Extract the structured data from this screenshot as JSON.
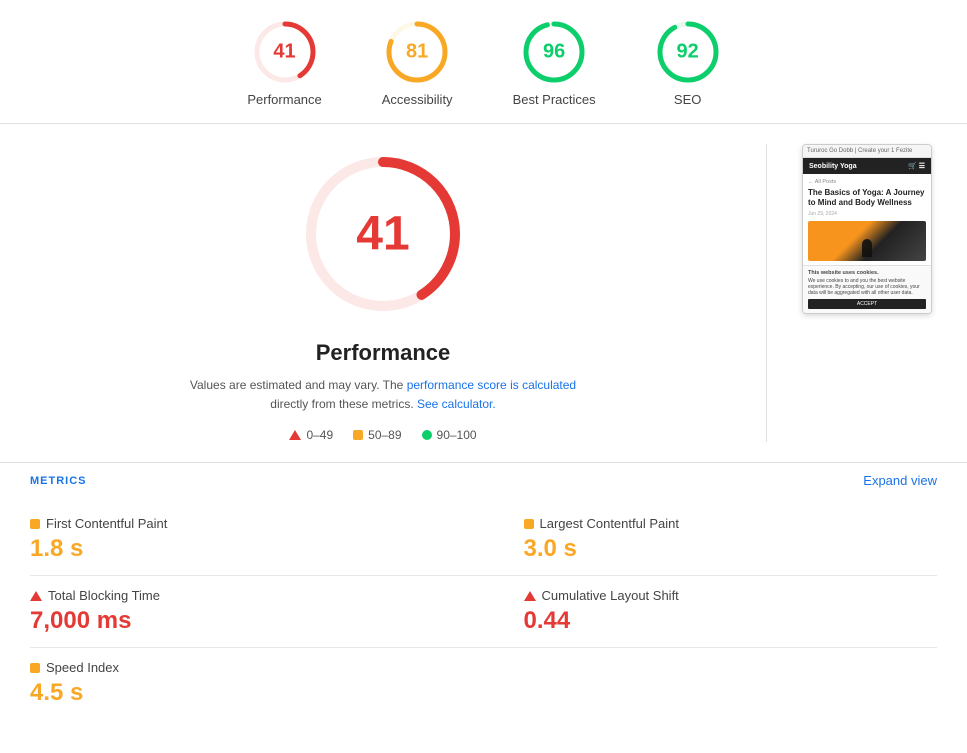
{
  "scores": [
    {
      "id": "performance",
      "label": "Performance",
      "value": 41,
      "color": "#e53935",
      "trackColor": "#fce8e6"
    },
    {
      "id": "accessibility",
      "label": "Accessibility",
      "value": 81,
      "color": "#f9a825",
      "trackColor": "#fef9e7"
    },
    {
      "id": "best-practices",
      "label": "Best Practices",
      "value": 96,
      "color": "#0cce6b",
      "trackColor": "#e6f9ef"
    },
    {
      "id": "seo",
      "label": "SEO",
      "value": 92,
      "color": "#0cce6b",
      "trackColor": "#e6f9ef"
    }
  ],
  "main": {
    "big_score": 41,
    "big_score_color": "#e53935",
    "big_track_color": "#fce8e6",
    "title": "Performance",
    "desc_text": "Values are estimated and may vary. The",
    "desc_link1": "performance score is calculated",
    "desc_link1_href": "#",
    "desc_mid": "directly from these metrics.",
    "desc_link2": "See calculator.",
    "desc_link2_href": "#"
  },
  "legend": [
    {
      "id": "red",
      "range": "0–49",
      "type": "triangle"
    },
    {
      "id": "orange",
      "range": "50–89",
      "type": "square"
    },
    {
      "id": "green",
      "range": "90–100",
      "type": "circle"
    }
  ],
  "metrics_section": {
    "label": "METRICS",
    "expand_label": "Expand view"
  },
  "metrics": [
    {
      "id": "fcp",
      "name": "First Contentful Paint",
      "value": "1.8 s",
      "icon": "square",
      "color": "orange"
    },
    {
      "id": "lcp",
      "name": "Largest Contentful Paint",
      "value": "3.0 s",
      "icon": "square",
      "color": "orange"
    },
    {
      "id": "tbt",
      "name": "Total Blocking Time",
      "value": "7,000 ms",
      "icon": "triangle",
      "color": "red"
    },
    {
      "id": "cls",
      "name": "Cumulative Layout Shift",
      "value": "0.44",
      "icon": "triangle",
      "color": "red"
    },
    {
      "id": "si",
      "name": "Speed Index",
      "value": "4.5 s",
      "icon": "square",
      "color": "orange"
    }
  ],
  "preview": {
    "topbar_text": "Tururoc Go Dobb | Create your 1 Fezite",
    "navbar_brand": "Seobility Yoga",
    "back_text": "← All Posts",
    "article_title": "The Basics of Yoga: A Journey to Mind and Body Wellness",
    "article_date": "Jun 29, 2024",
    "cookie_title": "This website uses cookies.",
    "cookie_text": "We use cookies to and you the best website experience. By accepting, our use of cookies, your data will be aggregated with all other user data.",
    "accept_label": "ACCEPT"
  }
}
